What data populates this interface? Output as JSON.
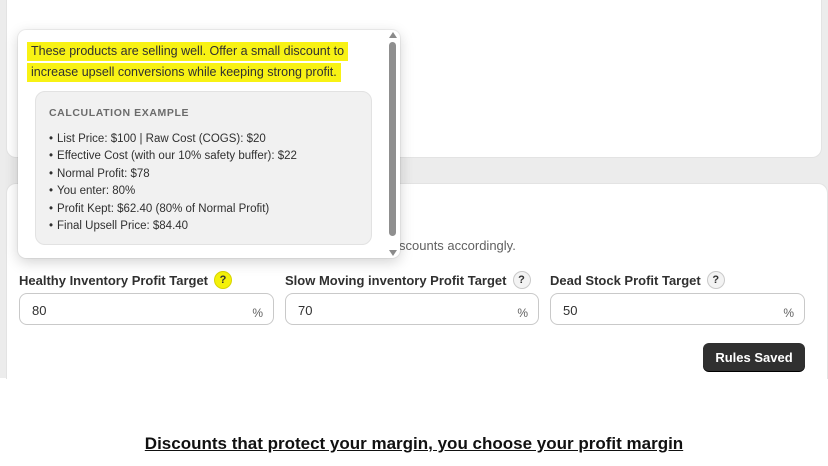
{
  "popover": {
    "message_line1": "These products are selling well. Offer a small discount to",
    "message_line2": "increase upsell conversions while keeping strong profit.",
    "calc_title": "CALCULATION EXAMPLE",
    "calc_items": [
      "List Price: $100 | Raw Cost (COGS): $20",
      "Effective Cost (with our 10% safety buffer): $22",
      "Normal Profit: $78",
      "You enter: 80%",
      "Profit Kept: $62.40 (80% of Normal Profit)",
      "Final Upsell Price: $84.40"
    ]
  },
  "description_fragment": "scounts accordingly.",
  "fields": [
    {
      "label": "Healthy Inventory Profit Target",
      "value": "80",
      "suffix": "%",
      "help": "?"
    },
    {
      "label": "Slow Moving inventory Profit Target",
      "value": "70",
      "suffix": "%",
      "help": "?"
    },
    {
      "label": "Dead Stock Profit Target",
      "value": "50",
      "suffix": "%",
      "help": "?"
    }
  ],
  "save_button": "Rules Saved",
  "caption": "Discounts that protect your margin, you choose your profit margin",
  "colors": {
    "highlight": "#f8f214",
    "button": "#303030"
  }
}
